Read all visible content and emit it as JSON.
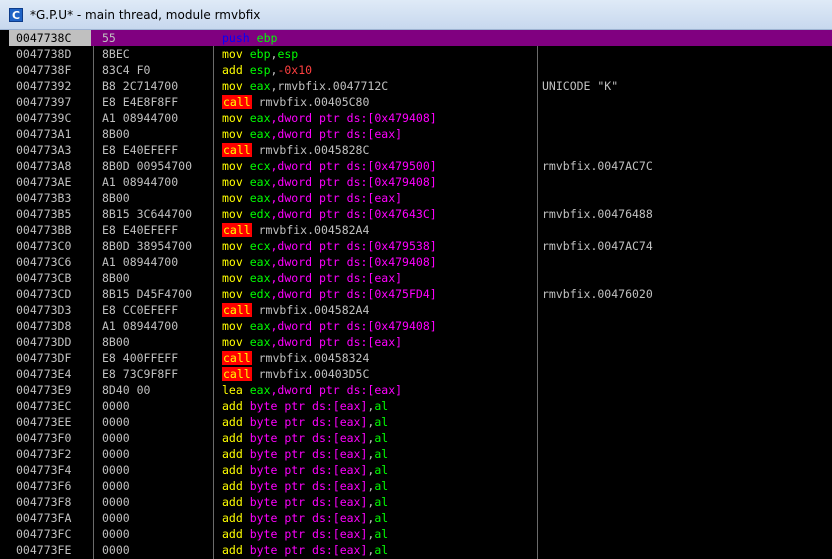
{
  "window": {
    "icon": "cpu-c-icon",
    "icon_text": "C",
    "title": "*G.P.U* - main thread, module rmvbfix"
  },
  "rows": [
    {
      "addr": "0047738C",
      "hex": "55",
      "instr": [
        {
          "t": "push",
          "c": "push"
        },
        {
          "t": " ",
          "c": "plain"
        },
        {
          "t": "ebp",
          "c": "reg"
        }
      ],
      "comment": "",
      "selected": true
    },
    {
      "addr": "0047738D",
      "hex": "8BEC",
      "instr": [
        {
          "t": "mov",
          "c": "kw"
        },
        {
          "t": " ",
          "c": "plain"
        },
        {
          "t": "ebp",
          "c": "reg"
        },
        {
          "t": ",",
          "c": "plain"
        },
        {
          "t": "esp",
          "c": "reg"
        }
      ],
      "comment": ""
    },
    {
      "addr": "0047738F",
      "hex": "83C4 F0",
      "instr": [
        {
          "t": "add",
          "c": "kw"
        },
        {
          "t": " ",
          "c": "plain"
        },
        {
          "t": "esp",
          "c": "reg"
        },
        {
          "t": ",",
          "c": "plain"
        },
        {
          "t": "-0x10",
          "c": "imm"
        }
      ],
      "comment": ""
    },
    {
      "addr": "00477392",
      "hex": "B8 2C714700",
      "instr": [
        {
          "t": "mov",
          "c": "kw"
        },
        {
          "t": " ",
          "c": "plain"
        },
        {
          "t": "eax",
          "c": "reg"
        },
        {
          "t": ",rmvbfix.0047712C",
          "c": "sym"
        }
      ],
      "comment": "UNICODE \"K\""
    },
    {
      "addr": "00477397",
      "hex": "E8 E4E8F8FF",
      "instr": [
        {
          "t": "call",
          "c": "call"
        },
        {
          "t": " rmvbfix.00405C80",
          "c": "sym"
        }
      ],
      "comment": ""
    },
    {
      "addr": "0047739C",
      "hex": "A1 08944700",
      "instr": [
        {
          "t": "mov",
          "c": "kw"
        },
        {
          "t": " ",
          "c": "plain"
        },
        {
          "t": "eax",
          "c": "reg"
        },
        {
          "t": ",dword ptr ds:[0x479408]",
          "c": "ptr"
        }
      ],
      "comment": ""
    },
    {
      "addr": "004773A1",
      "hex": "8B00",
      "instr": [
        {
          "t": "mov",
          "c": "kw"
        },
        {
          "t": " ",
          "c": "plain"
        },
        {
          "t": "eax",
          "c": "reg"
        },
        {
          "t": ",dword ptr ds:[eax]",
          "c": "ptr"
        }
      ],
      "comment": ""
    },
    {
      "addr": "004773A3",
      "hex": "E8 E40EFEFF",
      "instr": [
        {
          "t": "call",
          "c": "call"
        },
        {
          "t": " rmvbfix.0045828C",
          "c": "sym"
        }
      ],
      "comment": ""
    },
    {
      "addr": "004773A8",
      "hex": "8B0D 00954700",
      "instr": [
        {
          "t": "mov",
          "c": "kw"
        },
        {
          "t": " ",
          "c": "plain"
        },
        {
          "t": "ecx",
          "c": "reg"
        },
        {
          "t": ",dword ptr ds:[0x479500]",
          "c": "ptr"
        }
      ],
      "comment": "rmvbfix.0047AC7C"
    },
    {
      "addr": "004773AE",
      "hex": "A1 08944700",
      "instr": [
        {
          "t": "mov",
          "c": "kw"
        },
        {
          "t": " ",
          "c": "plain"
        },
        {
          "t": "eax",
          "c": "reg"
        },
        {
          "t": ",dword ptr ds:[0x479408]",
          "c": "ptr"
        }
      ],
      "comment": ""
    },
    {
      "addr": "004773B3",
      "hex": "8B00",
      "instr": [
        {
          "t": "mov",
          "c": "kw"
        },
        {
          "t": " ",
          "c": "plain"
        },
        {
          "t": "eax",
          "c": "reg"
        },
        {
          "t": ",dword ptr ds:[eax]",
          "c": "ptr"
        }
      ],
      "comment": ""
    },
    {
      "addr": "004773B5",
      "hex": "8B15 3C644700",
      "instr": [
        {
          "t": "mov",
          "c": "kw"
        },
        {
          "t": " ",
          "c": "plain"
        },
        {
          "t": "edx",
          "c": "reg"
        },
        {
          "t": ",dword ptr ds:[0x47643C]",
          "c": "ptr"
        }
      ],
      "comment": "rmvbfix.00476488"
    },
    {
      "addr": "004773BB",
      "hex": "E8 E40EFEFF",
      "instr": [
        {
          "t": "call",
          "c": "call"
        },
        {
          "t": " rmvbfix.004582A4",
          "c": "sym"
        }
      ],
      "comment": ""
    },
    {
      "addr": "004773C0",
      "hex": "8B0D 38954700",
      "instr": [
        {
          "t": "mov",
          "c": "kw"
        },
        {
          "t": " ",
          "c": "plain"
        },
        {
          "t": "ecx",
          "c": "reg"
        },
        {
          "t": ",dword ptr ds:[0x479538]",
          "c": "ptr"
        }
      ],
      "comment": "rmvbfix.0047AC74"
    },
    {
      "addr": "004773C6",
      "hex": "A1 08944700",
      "instr": [
        {
          "t": "mov",
          "c": "kw"
        },
        {
          "t": " ",
          "c": "plain"
        },
        {
          "t": "eax",
          "c": "reg"
        },
        {
          "t": ",dword ptr ds:[0x479408]",
          "c": "ptr"
        }
      ],
      "comment": ""
    },
    {
      "addr": "004773CB",
      "hex": "8B00",
      "instr": [
        {
          "t": "mov",
          "c": "kw"
        },
        {
          "t": " ",
          "c": "plain"
        },
        {
          "t": "eax",
          "c": "reg"
        },
        {
          "t": ",dword ptr ds:[eax]",
          "c": "ptr"
        }
      ],
      "comment": ""
    },
    {
      "addr": "004773CD",
      "hex": "8B15 D45F4700",
      "instr": [
        {
          "t": "mov",
          "c": "kw"
        },
        {
          "t": " ",
          "c": "plain"
        },
        {
          "t": "edx",
          "c": "reg"
        },
        {
          "t": ",dword ptr ds:[0x475FD4]",
          "c": "ptr"
        }
      ],
      "comment": "rmvbfix.00476020"
    },
    {
      "addr": "004773D3",
      "hex": "E8 CC0EFEFF",
      "instr": [
        {
          "t": "call",
          "c": "call"
        },
        {
          "t": " rmvbfix.004582A4",
          "c": "sym"
        }
      ],
      "comment": ""
    },
    {
      "addr": "004773D8",
      "hex": "A1 08944700",
      "instr": [
        {
          "t": "mov",
          "c": "kw"
        },
        {
          "t": " ",
          "c": "plain"
        },
        {
          "t": "eax",
          "c": "reg"
        },
        {
          "t": ",dword ptr ds:[0x479408]",
          "c": "ptr"
        }
      ],
      "comment": ""
    },
    {
      "addr": "004773DD",
      "hex": "8B00",
      "instr": [
        {
          "t": "mov",
          "c": "kw"
        },
        {
          "t": " ",
          "c": "plain"
        },
        {
          "t": "eax",
          "c": "reg"
        },
        {
          "t": ",dword ptr ds:[eax]",
          "c": "ptr"
        }
      ],
      "comment": ""
    },
    {
      "addr": "004773DF",
      "hex": "E8 400FFEFF",
      "instr": [
        {
          "t": "call",
          "c": "call"
        },
        {
          "t": " rmvbfix.00458324",
          "c": "sym"
        }
      ],
      "comment": ""
    },
    {
      "addr": "004773E4",
      "hex": "E8 73C9F8FF",
      "instr": [
        {
          "t": "call",
          "c": "call"
        },
        {
          "t": " rmvbfix.00403D5C",
          "c": "sym"
        }
      ],
      "comment": ""
    },
    {
      "addr": "004773E9",
      "hex": "8D40 00",
      "instr": [
        {
          "t": "lea",
          "c": "kw"
        },
        {
          "t": " ",
          "c": "plain"
        },
        {
          "t": "eax",
          "c": "reg"
        },
        {
          "t": ",dword ptr ds:[eax]",
          "c": "ptr"
        }
      ],
      "comment": ""
    },
    {
      "addr": "004773EC",
      "hex": "0000",
      "instr": [
        {
          "t": "add",
          "c": "kw"
        },
        {
          "t": " byte ptr ds:[eax]",
          "c": "ptr"
        },
        {
          "t": ",",
          "c": "plain"
        },
        {
          "t": "al",
          "c": "reg"
        }
      ],
      "comment": ""
    },
    {
      "addr": "004773EE",
      "hex": "0000",
      "instr": [
        {
          "t": "add",
          "c": "kw"
        },
        {
          "t": " byte ptr ds:[eax]",
          "c": "ptr"
        },
        {
          "t": ",",
          "c": "plain"
        },
        {
          "t": "al",
          "c": "reg"
        }
      ],
      "comment": ""
    },
    {
      "addr": "004773F0",
      "hex": "0000",
      "instr": [
        {
          "t": "add",
          "c": "kw"
        },
        {
          "t": " byte ptr ds:[eax]",
          "c": "ptr"
        },
        {
          "t": ",",
          "c": "plain"
        },
        {
          "t": "al",
          "c": "reg"
        }
      ],
      "comment": ""
    },
    {
      "addr": "004773F2",
      "hex": "0000",
      "instr": [
        {
          "t": "add",
          "c": "kw"
        },
        {
          "t": " byte ptr ds:[eax]",
          "c": "ptr"
        },
        {
          "t": ",",
          "c": "plain"
        },
        {
          "t": "al",
          "c": "reg"
        }
      ],
      "comment": ""
    },
    {
      "addr": "004773F4",
      "hex": "0000",
      "instr": [
        {
          "t": "add",
          "c": "kw"
        },
        {
          "t": " byte ptr ds:[eax]",
          "c": "ptr"
        },
        {
          "t": ",",
          "c": "plain"
        },
        {
          "t": "al",
          "c": "reg"
        }
      ],
      "comment": ""
    },
    {
      "addr": "004773F6",
      "hex": "0000",
      "instr": [
        {
          "t": "add",
          "c": "kw"
        },
        {
          "t": " byte ptr ds:[eax]",
          "c": "ptr"
        },
        {
          "t": ",",
          "c": "plain"
        },
        {
          "t": "al",
          "c": "reg"
        }
      ],
      "comment": ""
    },
    {
      "addr": "004773F8",
      "hex": "0000",
      "instr": [
        {
          "t": "add",
          "c": "kw"
        },
        {
          "t": " byte ptr ds:[eax]",
          "c": "ptr"
        },
        {
          "t": ",",
          "c": "plain"
        },
        {
          "t": "al",
          "c": "reg"
        }
      ],
      "comment": ""
    },
    {
      "addr": "004773FA",
      "hex": "0000",
      "instr": [
        {
          "t": "add",
          "c": "kw"
        },
        {
          "t": " byte ptr ds:[eax]",
          "c": "ptr"
        },
        {
          "t": ",",
          "c": "plain"
        },
        {
          "t": "al",
          "c": "reg"
        }
      ],
      "comment": ""
    },
    {
      "addr": "004773FC",
      "hex": "0000",
      "instr": [
        {
          "t": "add",
          "c": "kw"
        },
        {
          "t": " byte ptr ds:[eax]",
          "c": "ptr"
        },
        {
          "t": ",",
          "c": "plain"
        },
        {
          "t": "al",
          "c": "reg"
        }
      ],
      "comment": ""
    },
    {
      "addr": "004773FE",
      "hex": "0000",
      "instr": [
        {
          "t": "add",
          "c": "kw"
        },
        {
          "t": " byte ptr ds:[eax]",
          "c": "ptr"
        },
        {
          "t": ",",
          "c": "plain"
        },
        {
          "t": "al",
          "c": "reg"
        }
      ],
      "comment": ""
    }
  ]
}
